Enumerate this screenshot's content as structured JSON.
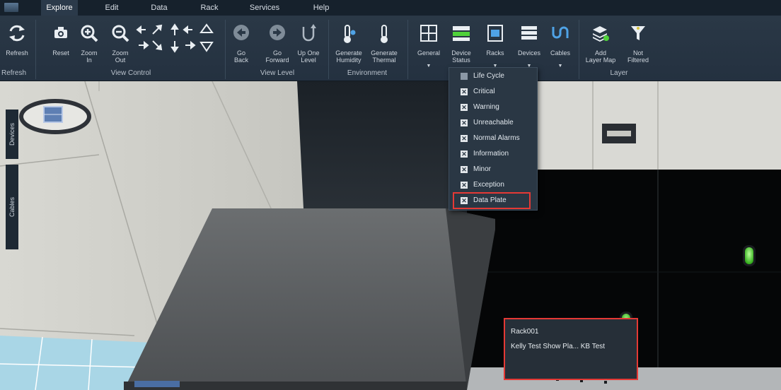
{
  "menubar": {
    "tabs": [
      {
        "label": "Explore",
        "active": true
      },
      {
        "label": "Edit",
        "active": false
      },
      {
        "label": "Data",
        "active": false
      },
      {
        "label": "Rack",
        "active": false
      },
      {
        "label": "Services",
        "active": false
      },
      {
        "label": "Help",
        "active": false
      }
    ]
  },
  "ribbon": {
    "refresh": {
      "label": "Refresh",
      "group": "Refresh"
    },
    "view_control": {
      "group": "View Control",
      "reset": "Reset",
      "zoom_in": "Zoom\nIn",
      "zoom_out": "Zoom\nOut"
    },
    "view_level": {
      "group": "View Level",
      "go_back": "Go\nBack",
      "go_forward": "Go\nForward",
      "up_one_level": "Up One\nLevel"
    },
    "environment": {
      "group": "Environment",
      "generate_humidity": "Generate\nHumidity",
      "generate_thermal": "Generate\nThermal"
    },
    "display": {
      "general": "General",
      "device_status": "Device\nStatus",
      "racks": "Racks",
      "devices": "Devices",
      "cables": "Cables"
    },
    "layer": {
      "group": "Layer",
      "add_layer_map": "Add\nLayer Map",
      "not_filtered": "Not\nFiltered"
    },
    "dropdown_glyph": "▼"
  },
  "side_tabs": {
    "devices": "Devices",
    "cables": "Cables"
  },
  "device_status_menu": {
    "items": [
      {
        "label": "Life Cycle",
        "checked": false
      },
      {
        "label": "Critical",
        "checked": true
      },
      {
        "label": "Warning",
        "checked": true
      },
      {
        "label": "Unreachable",
        "checked": true
      },
      {
        "label": "Normal Alarms",
        "checked": true
      },
      {
        "label": "Information",
        "checked": true
      },
      {
        "label": "Minor",
        "checked": true
      },
      {
        "label": "Exception",
        "checked": true
      },
      {
        "label": "Data Plate",
        "checked": true,
        "highlighted": true
      }
    ]
  },
  "rack_popup": {
    "name": "Rack001",
    "details": "Kelly Test Show Pla... KB Test"
  },
  "colors": {
    "highlight": "#e53935",
    "ribbon_bg": "#2a3846",
    "status_green": "#4fd13a"
  }
}
